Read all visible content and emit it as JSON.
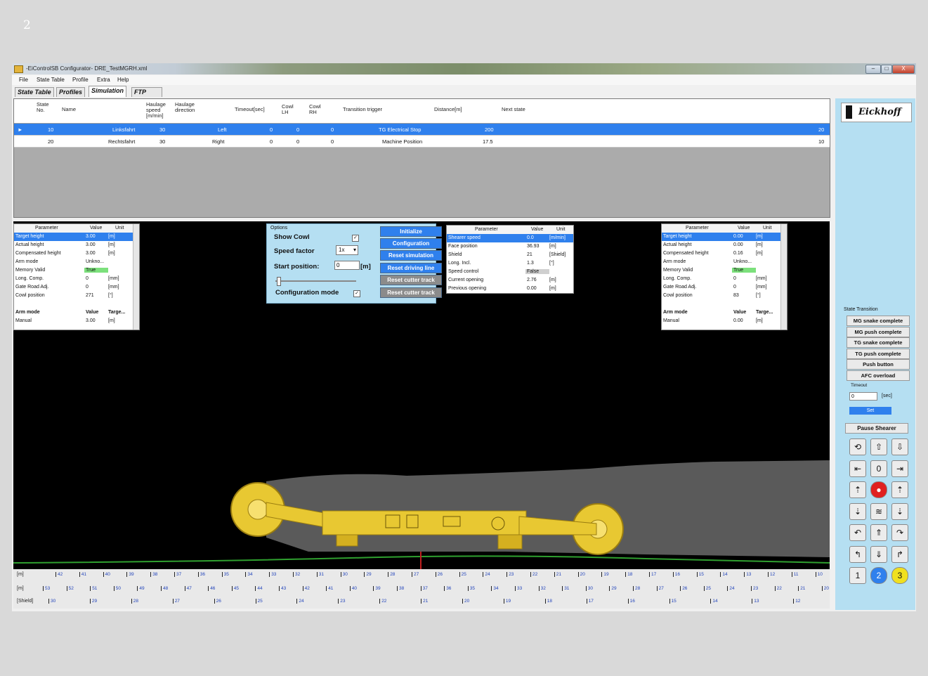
{
  "page_number": "2",
  "window": {
    "title": "-EiControlSB Configurator-   DRE_TestMGRH.xml",
    "buttons": {
      "minimize": "–",
      "maximize": "□",
      "close": "X"
    }
  },
  "menu": [
    "File",
    "State Table",
    "Profile",
    "Extra",
    "Help"
  ],
  "tabs": [
    {
      "label": "State Table",
      "active": false
    },
    {
      "label": "Profiles",
      "active": false
    },
    {
      "label": "Simulation",
      "active": true
    },
    {
      "label": "FTP",
      "active": false
    }
  ],
  "state_table": {
    "headers": [
      "State\nNo.",
      "Name",
      "Haulage\nspeed\n[m/min]",
      "Haulage\ndirection",
      "Timeout[sec]",
      "Cowl\nLH",
      "Cowl\nRH",
      "Transition trigger",
      "Distance[m]",
      "Next state"
    ],
    "rows": [
      {
        "state": "10",
        "name": "Linksfahrt",
        "speed": "30",
        "direction": "Left",
        "timeout": "0",
        "cowl_lh": "0",
        "cowl_rh": "0",
        "trigger": "TG Electrical Stop",
        "distance": "200",
        "next": "20",
        "selected": true
      },
      {
        "state": "20",
        "name": "Rechtsfahrt",
        "speed": "30",
        "direction": "Right",
        "timeout": "0",
        "cowl_lh": "0",
        "cowl_rh": "0",
        "trigger": "Machine Position",
        "distance": "17.5",
        "next": "10",
        "selected": false
      }
    ]
  },
  "left_params": {
    "headers": [
      "Parameter",
      "Value",
      "Unit"
    ],
    "rows": [
      [
        "Target height",
        "3.00",
        "[m]"
      ],
      [
        "Actual height",
        "3.00",
        "[m]"
      ],
      [
        "Compensated height",
        "3.00",
        "[m]"
      ],
      [
        "Arm mode",
        "Unkno...",
        ""
      ],
      [
        "Memory Valid",
        "True",
        ""
      ],
      [
        "Long. Comp.",
        "0",
        "[mm]"
      ],
      [
        "Gate Road Adj.",
        "0",
        "[mm]"
      ],
      [
        "Cowl position",
        "271",
        "[°]"
      ]
    ],
    "arm_headers": [
      "Arm mode",
      "Value",
      "Targe..."
    ],
    "arm_row": [
      "Manual",
      "3.00",
      "[m]"
    ]
  },
  "right_params": {
    "headers": [
      "Parameter",
      "Value",
      "Unit"
    ],
    "rows": [
      [
        "Target height",
        "0.00",
        "[m]"
      ],
      [
        "Actual height",
        "0.00",
        "[m]"
      ],
      [
        "Compensated height",
        "0.16",
        "[m]"
      ],
      [
        "Arm mode",
        "Unkno...",
        ""
      ],
      [
        "Memory Valid",
        "True",
        ""
      ],
      [
        "Long. Comp.",
        "0",
        "[mm]"
      ],
      [
        "Gate Road Adj.",
        "0",
        "[mm]"
      ],
      [
        "Cowl position",
        "83",
        "[°]"
      ]
    ],
    "arm_headers": [
      "Arm mode",
      "Value",
      "Targe..."
    ],
    "arm_row": [
      "Manual",
      "0.00",
      "[m]"
    ]
  },
  "options": {
    "group": "Options",
    "show_cowl": "Show Cowl",
    "speed_factor": "Speed factor",
    "speed_value": "1x",
    "start_position": "Start position:",
    "start_value": "0",
    "start_unit": "[m]",
    "config_mode": "Configuration mode",
    "check": "✓"
  },
  "sim_buttons": [
    "Initialize",
    "Configuration",
    "Reset simulation",
    "Reset driving line",
    "Reset cutter track",
    "Reset cutter track"
  ],
  "shearer_params": {
    "headers": [
      "Parameter",
      "Value",
      "Unit"
    ],
    "rows": [
      [
        "Shearer speed",
        "0.0",
        "[m/min]"
      ],
      [
        "Face position",
        "36.93",
        "[m]"
      ],
      [
        "Shield",
        "21",
        "[Shield]"
      ],
      [
        "Long. Incl.",
        "1.3",
        "[°]"
      ],
      [
        "Speed control",
        "False",
        ""
      ],
      [
        "Current opening",
        "2.76",
        "[m]"
      ],
      [
        "Previous opening",
        "0.00",
        "[m]"
      ]
    ]
  },
  "control_panel": {
    "logo": "Eickhoff",
    "state_transition": "State Transition",
    "transition_buttons": [
      "MG snake complete",
      "MG push complete",
      "TG snake complete",
      "TG push complete",
      "Push button",
      "AFC overload"
    ],
    "timeout_label": "Timeout",
    "timeout_value": "0",
    "timeout_unit": "[sec]",
    "set_label": "Set",
    "pause_label": "Pause Shearer",
    "icon_rows": [
      [
        "⟲",
        "⇧",
        "⇩"
      ],
      [
        "⇤",
        "0",
        "⇥"
      ],
      [
        "⇡",
        "●",
        "⇡"
      ],
      [
        "⇣",
        "≋",
        "⇣"
      ],
      [
        "↶",
        "⇑",
        "↷"
      ],
      [
        "↰",
        "⇓",
        "↱"
      ],
      [
        "1",
        "2",
        "3"
      ]
    ]
  },
  "ruler": {
    "m_label": "[m]",
    "shield_label": "[Shield]",
    "row1": [
      "42",
      "41",
      "40",
      "39",
      "38",
      "37",
      "36",
      "35",
      "34",
      "33",
      "32",
      "31",
      "30",
      "29",
      "28",
      "27",
      "26",
      "25",
      "24",
      "23",
      "22",
      "21",
      "20",
      "19",
      "18",
      "17",
      "16",
      "15",
      "14",
      "13",
      "12",
      "11",
      "10"
    ],
    "row2": [
      "53",
      "52",
      "51",
      "50",
      "49",
      "48",
      "47",
      "46",
      "45",
      "44",
      "43",
      "42",
      "41",
      "40",
      "39",
      "38",
      "37",
      "36",
      "35",
      "34",
      "33",
      "32",
      "31",
      "30",
      "29",
      "28",
      "27",
      "26",
      "25",
      "24",
      "23",
      "22",
      "21",
      "20"
    ],
    "row3": [
      "30",
      "29",
      "28",
      "27",
      "26",
      "25",
      "24",
      "23",
      "22",
      "21",
      "20",
      "19",
      "18",
      "17",
      "16",
      "15",
      "14",
      "13",
      "12"
    ]
  },
  "colors": {
    "selection": "#2f80ed",
    "machine": "#e8c832",
    "panel": "#b5dff2",
    "floor_line": "#2fa02f",
    "true_cell": "#7ce07c"
  }
}
